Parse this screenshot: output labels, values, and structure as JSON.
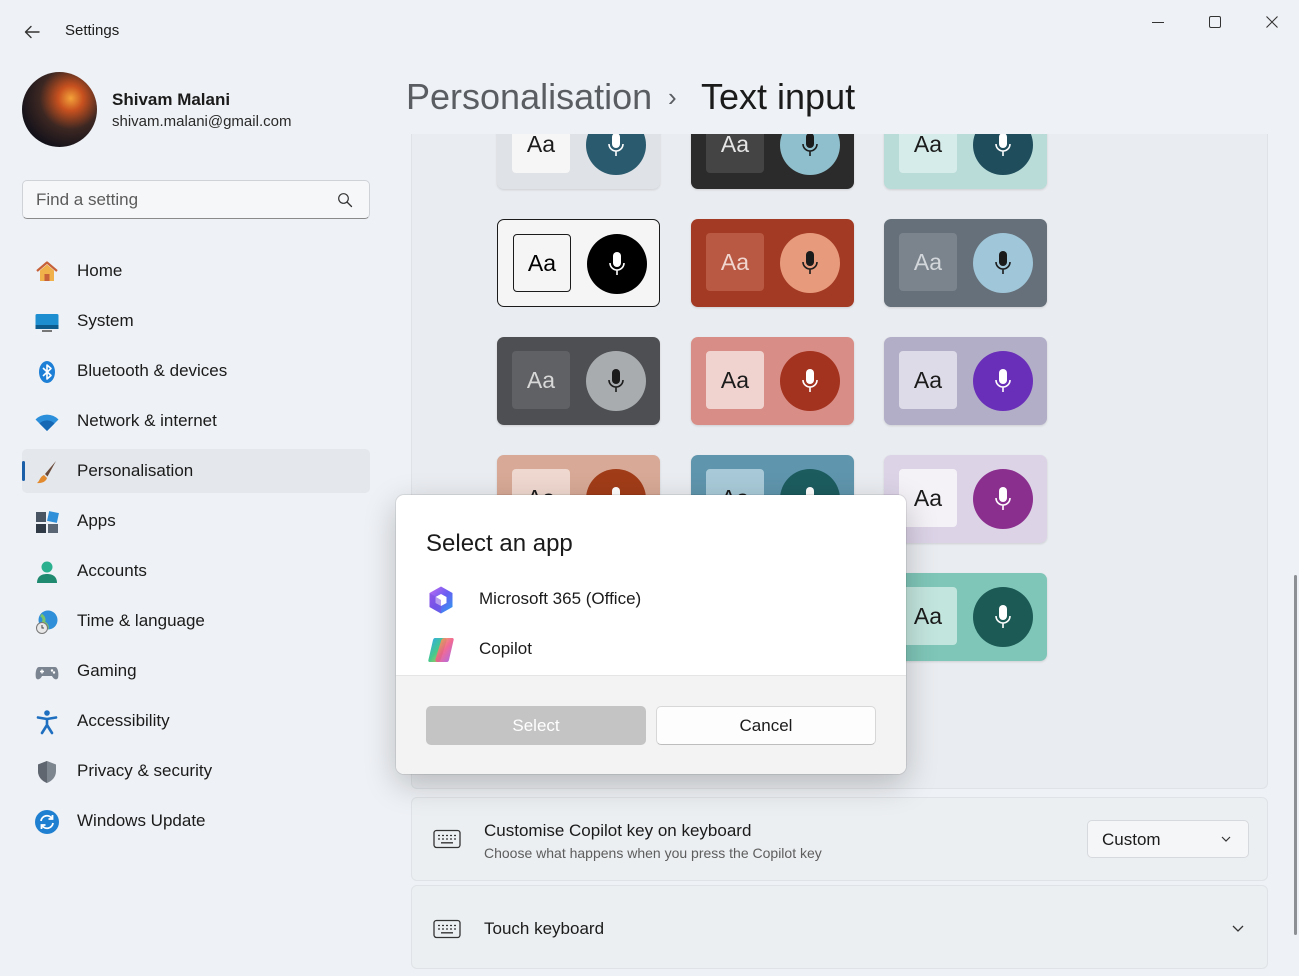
{
  "window": {
    "title": "Settings",
    "controls": [
      "minimize-icon",
      "maximize-icon",
      "close-icon"
    ]
  },
  "profile": {
    "name": "Shivam Malani",
    "email": "shivam.malani@gmail.com"
  },
  "search": {
    "placeholder": "Find a setting"
  },
  "sidebar": {
    "items": [
      {
        "label": "Home",
        "icon": "home-icon"
      },
      {
        "label": "System",
        "icon": "system-icon"
      },
      {
        "label": "Bluetooth & devices",
        "icon": "bluetooth-icon"
      },
      {
        "label": "Network & internet",
        "icon": "wifi-icon"
      },
      {
        "label": "Personalisation",
        "icon": "brush-icon",
        "selected": true
      },
      {
        "label": "Apps",
        "icon": "apps-icon"
      },
      {
        "label": "Accounts",
        "icon": "person-icon"
      },
      {
        "label": "Time & language",
        "icon": "globe-clock-icon"
      },
      {
        "label": "Gaming",
        "icon": "gamepad-icon"
      },
      {
        "label": "Accessibility",
        "icon": "accessibility-icon"
      },
      {
        "label": "Privacy & security",
        "icon": "shield-icon"
      },
      {
        "label": "Windows Update",
        "icon": "update-icon"
      }
    ]
  },
  "header": {
    "parent": "Personalisation",
    "separator": "›",
    "title": "Text input"
  },
  "themes": {
    "tile_text": "Aa",
    "tiles": [
      {
        "name": "light",
        "bg": "#dfe2e6",
        "aa_bg": "#f6f6f6",
        "aa_fg": "#1b1b1b",
        "mic_bg": "#2a5a6e"
      },
      {
        "name": "dark",
        "bg": "#2b2b2b",
        "aa_bg": "#444444",
        "aa_fg": "#e6e6e6",
        "mic_bg": "#8fbfcc"
      },
      {
        "name": "aqua",
        "bg": "#b9dcd9",
        "aa_bg": "#d6ecea",
        "aa_fg": "#1b1b1b",
        "mic_bg": "#1f4d5c"
      },
      {
        "name": "high-contrast",
        "bg": "#f5f5f5",
        "aa_bg": "#f5f5f5",
        "aa_fg": "#000000",
        "mic_bg": "#000000",
        "selected": true
      },
      {
        "name": "red",
        "bg": "#a33a24",
        "aa_bg": "#b95943",
        "aa_fg": "#f0d6cf",
        "mic_bg": "#e89a7d"
      },
      {
        "name": "slate",
        "bg": "#66707a",
        "aa_bg": "#7b848d",
        "aa_fg": "#d3d7db",
        "mic_bg": "#9fc6d9"
      },
      {
        "name": "charcoal",
        "bg": "#4d4f52",
        "aa_bg": "#5f6164",
        "aa_fg": "#d8d8d8",
        "mic_bg": "#a9acaf"
      },
      {
        "name": "bloom-red",
        "bg": "#d88e86",
        "aa_bg": "#f0d3cf",
        "aa_fg": "#1b1b1b",
        "mic_bg": "#a3321e"
      },
      {
        "name": "bloom-purple",
        "bg": "#b2aec8",
        "aa_bg": "#dedbe8",
        "aa_fg": "#1b1b1b",
        "mic_bg": "#6a2fb8"
      },
      {
        "name": "sunrise",
        "bg": "#d7a996",
        "aa_bg": "#efd8cf",
        "aa_fg": "#1b1b1b",
        "mic_bg": "#a13c18"
      },
      {
        "name": "ocean",
        "bg": "#5f95ad",
        "aa_bg": "#a8cad8",
        "aa_fg": "#1b1b1b",
        "mic_bg": "#1c5c5f"
      },
      {
        "name": "lavender",
        "bg": "#dcd3e7",
        "aa_bg": "#f4f1f7",
        "aa_fg": "#1b1b1b",
        "mic_bg": "#8b2f8e"
      },
      {
        "name": "teal-green",
        "bg": "#7fc6b8",
        "aa_bg": "#c2e5dd",
        "aa_fg": "#1b1b1b",
        "mic_bg": "#1c5a55"
      }
    ]
  },
  "copilot_key": {
    "title": "Customise Copilot key on keyboard",
    "description": "Choose what happens when you press the Copilot key",
    "dropdown_value": "Custom"
  },
  "touch_keyboard": {
    "title": "Touch keyboard"
  },
  "dialog": {
    "title": "Select an app",
    "apps": [
      {
        "label": "Microsoft 365 (Office)",
        "icon": "microsoft-365-icon"
      },
      {
        "label": "Copilot",
        "icon": "copilot-icon"
      }
    ],
    "select_label": "Select",
    "cancel_label": "Cancel"
  }
}
